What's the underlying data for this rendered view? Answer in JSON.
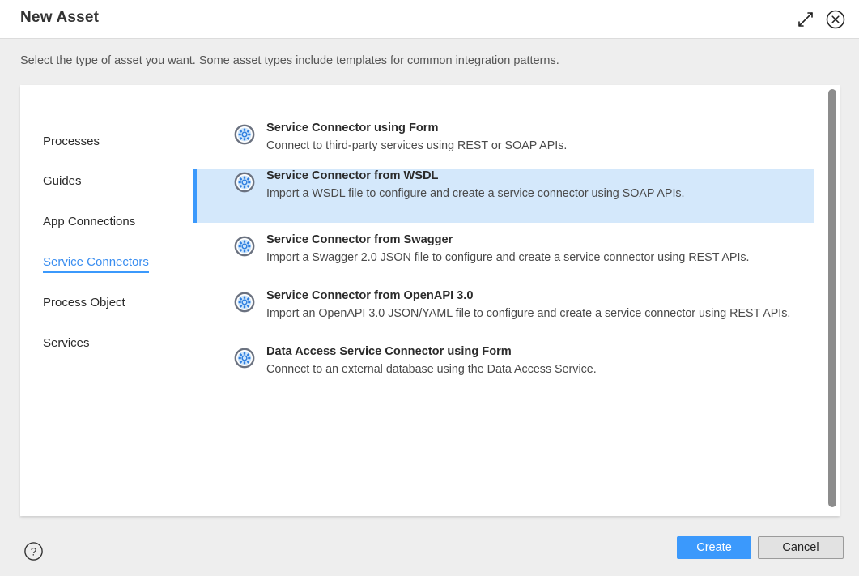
{
  "dialog": {
    "title": "New Asset",
    "instruction": "Select the type of asset you want. Some asset types include templates for common integration patterns.",
    "expand_label": "Expand",
    "close_label": "Close"
  },
  "sidebar": {
    "items": [
      {
        "label": "Processes",
        "active": false
      },
      {
        "label": "Guides",
        "active": false
      },
      {
        "label": "App Connections",
        "active": false
      },
      {
        "label": "Service Connectors",
        "active": true
      },
      {
        "label": "Process Object",
        "active": false
      },
      {
        "label": "Services",
        "active": false
      }
    ]
  },
  "options": [
    {
      "title": "Service Connector using Form",
      "description": "Connect to third-party services using REST or SOAP APIs.",
      "icon": "gear-circle-icon",
      "selected": false
    },
    {
      "title": "Service Connector from WSDL",
      "description": "Import a WSDL file to configure and create a service connector using SOAP APIs.",
      "icon": "gear-circle-icon",
      "selected": true
    },
    {
      "title": "Service Connector from Swagger",
      "description": "Import a Swagger 2.0 JSON file to configure and create a service connector using REST APIs.",
      "icon": "gear-circle-icon",
      "selected": false
    },
    {
      "title": "Service Connector from OpenAPI 3.0",
      "description": "Import an OpenAPI 3.0 JSON/YAML file to configure and create a service connector using REST APIs.",
      "icon": "gear-circle-icon",
      "selected": false
    },
    {
      "title": "Data Access Service Connector using Form",
      "description": "Connect to an external database using the Data Access Service.",
      "icon": "gear-circle-icon",
      "selected": false
    }
  ],
  "footer": {
    "help_label": "Help",
    "create_label": "Create",
    "cancel_label": "Cancel"
  },
  "colors": {
    "accent": "#3b99fc",
    "selected_row_bg": "#d4e8fb",
    "page_bg": "#eeeeee",
    "panel_bg": "#ffffff",
    "scrollbar": "#8c8c8c"
  }
}
